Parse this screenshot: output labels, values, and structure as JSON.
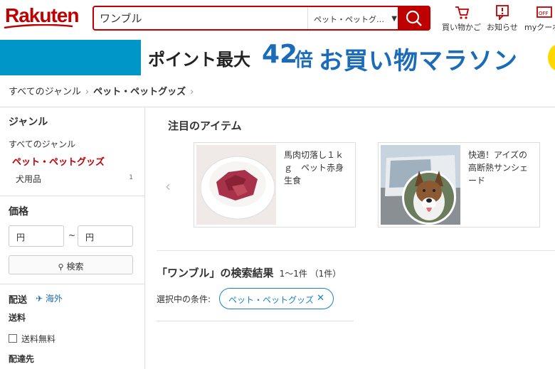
{
  "header": {
    "logo": "Rakuten",
    "search_value": "ワンブル",
    "category_select": "ペット・ペットグ…",
    "links": [
      {
        "label": "買い物かご",
        "icon": "cart-icon"
      },
      {
        "label": "お知らせ",
        "icon": "notice-icon"
      },
      {
        "label": "myクーポ",
        "icon": "coupon-icon"
      }
    ]
  },
  "banner": {
    "text_a": "ポイント最大",
    "number": "42",
    "text_b": "倍",
    "text_c": "お買い物マラソン"
  },
  "breadcrumb": [
    "すべてのジャンル",
    "ペット・ペットグッズ"
  ],
  "sidebar": {
    "genre_title": "ジャンル",
    "all_genres": "すべてのジャンル",
    "active_genre": "ペット・ペットグッズ",
    "sub_genre": "犬用品",
    "sub_genre_count": "1",
    "price_title": "価格",
    "price_min": "円",
    "price_max": "円",
    "tilde": "~",
    "search_label": "検索",
    "shipping_title": "配送",
    "overseas": "海外",
    "postage_title": "送料",
    "free_shipping": "送料無料",
    "destination_title": "配達先"
  },
  "main": {
    "featured_title": "注目のアイテム",
    "cards": [
      {
        "text": "馬肉切落し１ｋｇ　ペット赤身生食"
      },
      {
        "text": "快適！アイズの高断熱サンシェード"
      }
    ],
    "results_title": "「ワンブル」の検索結果",
    "results_count": "1～1件 （1件）",
    "condition_label": "選択中の条件:",
    "chip_label": "ペット・ペットグッズ"
  },
  "colors": {
    "brand": "#bf0000",
    "accent": "#1a82c4",
    "banner": "#0096c8"
  }
}
